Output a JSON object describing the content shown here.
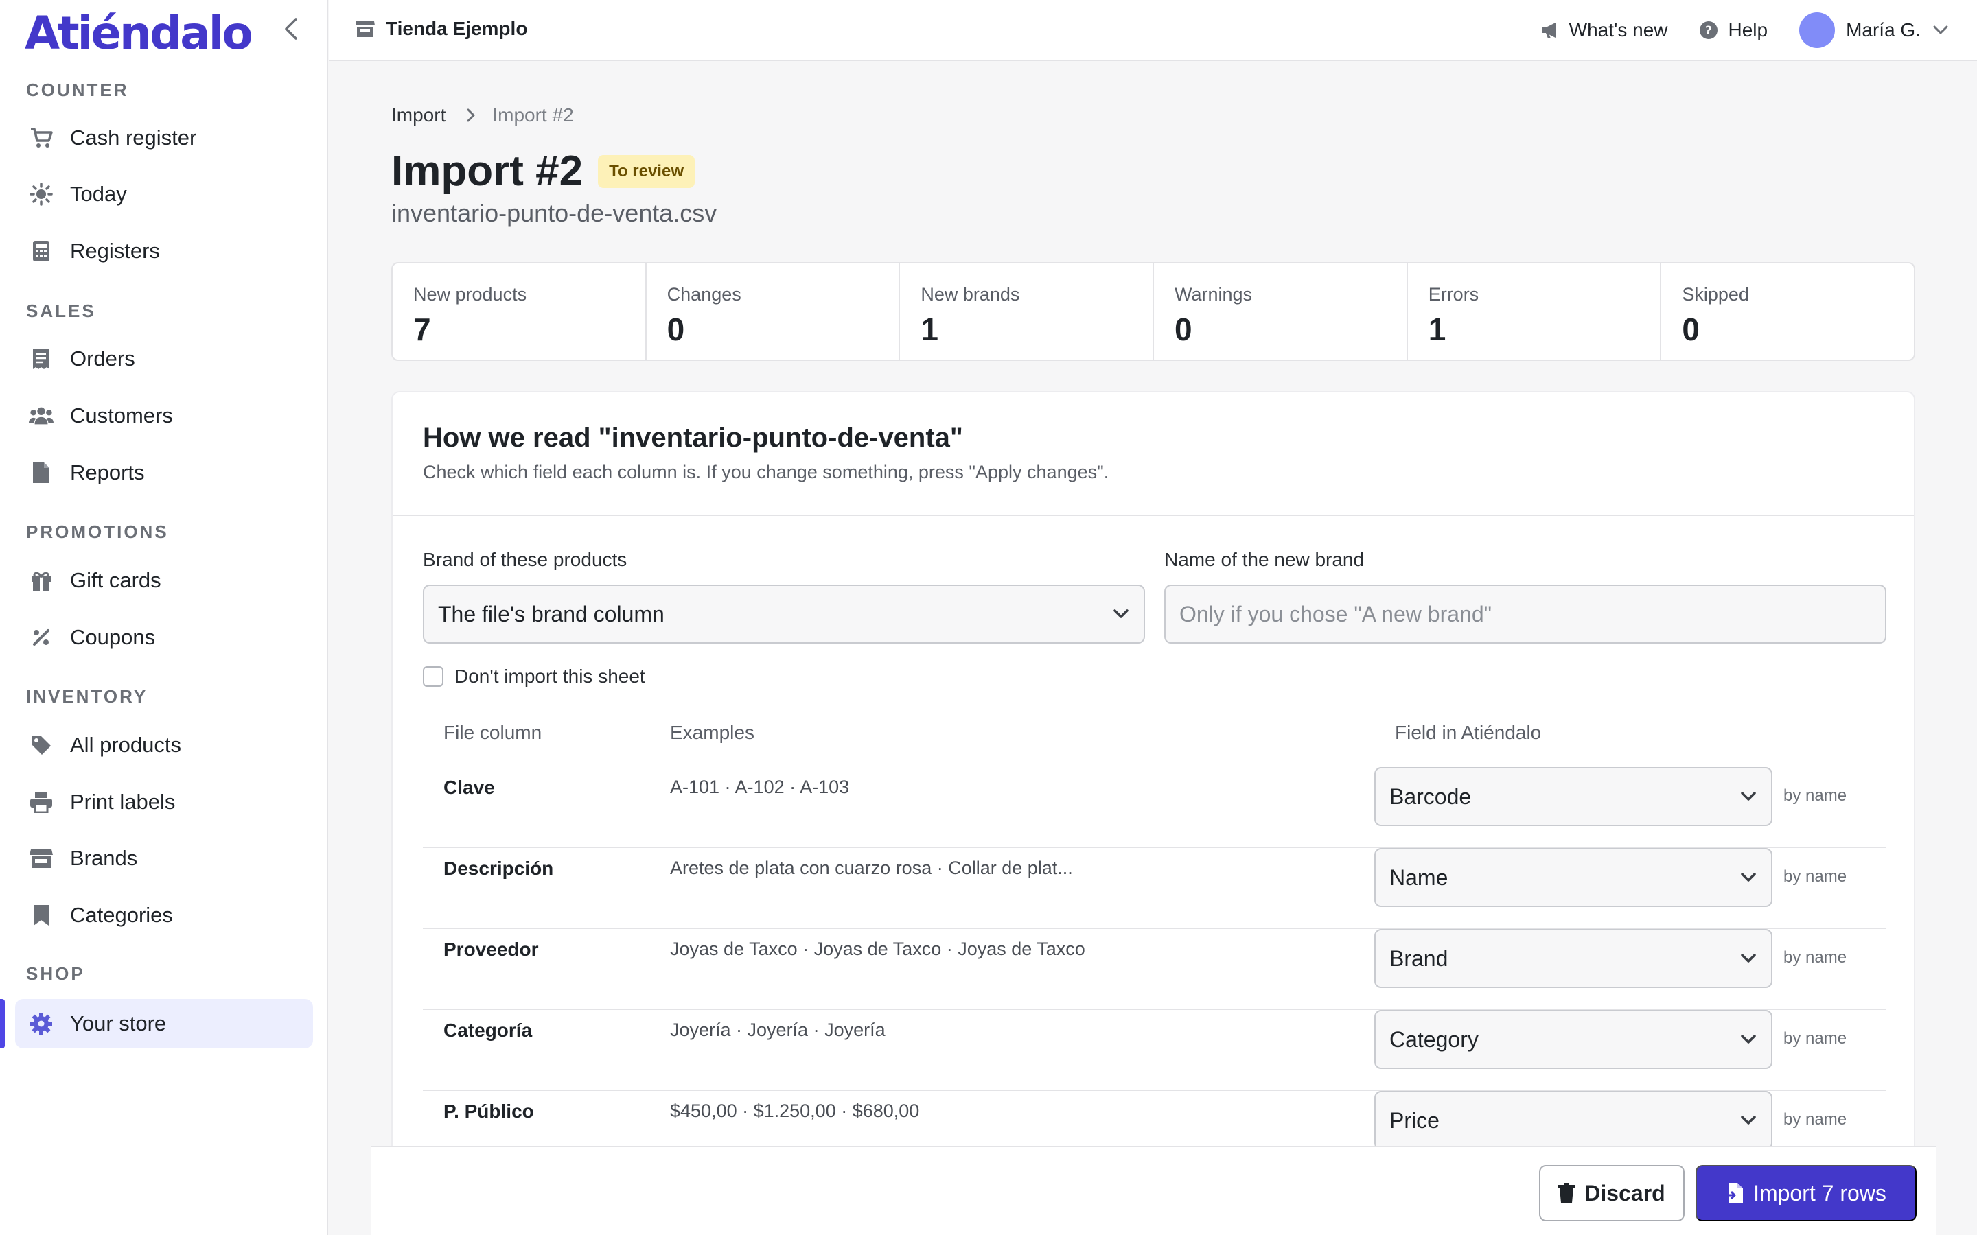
{
  "app": {
    "logo": "Atiéndalo"
  },
  "sidebar": {
    "sections": [
      {
        "label": "COUNTER",
        "items": [
          {
            "label": "Cash register",
            "icon": "cart-icon"
          },
          {
            "label": "Today",
            "icon": "sun-icon"
          },
          {
            "label": "Registers",
            "icon": "calculator-icon"
          }
        ]
      },
      {
        "label": "SALES",
        "items": [
          {
            "label": "Orders",
            "icon": "receipt-icon"
          },
          {
            "label": "Customers",
            "icon": "users-icon"
          },
          {
            "label": "Reports",
            "icon": "file-icon"
          }
        ]
      },
      {
        "label": "PROMOTIONS",
        "items": [
          {
            "label": "Gift cards",
            "icon": "gift-icon"
          },
          {
            "label": "Coupons",
            "icon": "percent-icon"
          }
        ]
      },
      {
        "label": "INVENTORY",
        "items": [
          {
            "label": "All products",
            "icon": "tag-icon"
          },
          {
            "label": "Print labels",
            "icon": "printer-icon"
          },
          {
            "label": "Brands",
            "icon": "store-icon"
          },
          {
            "label": "Categories",
            "icon": "bookmark-icon"
          }
        ]
      },
      {
        "label": "SHOP",
        "items": [
          {
            "label": "Your store",
            "icon": "gear-icon",
            "active": true
          }
        ]
      }
    ]
  },
  "topbar": {
    "store_name": "Tienda Ejemplo",
    "whats_new": "What's new",
    "help": "Help",
    "user_name": "María G."
  },
  "breadcrumb": {
    "parent": "Import",
    "current": "Import #2"
  },
  "page": {
    "title": "Import #2",
    "status_badge": "To review",
    "filename": "inventario-punto-de-venta.csv"
  },
  "stats": [
    {
      "label": "New products",
      "value": "7"
    },
    {
      "label": "Changes",
      "value": "0"
    },
    {
      "label": "New brands",
      "value": "1"
    },
    {
      "label": "Warnings",
      "value": "0"
    },
    {
      "label": "Errors",
      "value": "1"
    },
    {
      "label": "Skipped",
      "value": "0"
    }
  ],
  "mapping": {
    "title": "How we read \"inventario-punto-de-venta\"",
    "subtitle": "Check which field each column is. If you change something, press \"Apply changes\".",
    "brand_label": "Brand of these products",
    "brand_value": "The file's brand column",
    "new_brand_label": "Name of the new brand",
    "new_brand_placeholder": "Only if you chose \"A new brand\"",
    "skip_sheet_label": "Don't import this sheet",
    "headers": {
      "column": "File column",
      "examples": "Examples",
      "field": "Field in Atiéndalo"
    },
    "rows": [
      {
        "column": "Clave",
        "examples": "A-101 · A-102 · A-103",
        "field": "Barcode",
        "hint": "by name"
      },
      {
        "column": "Descripción",
        "examples": "Aretes de plata con cuarzo rosa · Collar de plat...",
        "field": "Name",
        "hint": "by name"
      },
      {
        "column": "Proveedor",
        "examples": "Joyas de Taxco · Joyas de Taxco · Joyas de Taxco",
        "field": "Brand",
        "hint": "by name"
      },
      {
        "column": "Categoría",
        "examples": "Joyería · Joyería · Joyería",
        "field": "Category",
        "hint": "by name"
      },
      {
        "column": "P. Público",
        "examples": "$450,00 · $1.250,00 · $680,00",
        "field": "Price",
        "hint": "by name"
      }
    ]
  },
  "footer": {
    "discard": "Discard",
    "import": "Import 7 rows"
  },
  "colors": {
    "accent": "#4338ca",
    "badge_bg": "#fdf1b8",
    "active_bg": "#eceefe"
  }
}
